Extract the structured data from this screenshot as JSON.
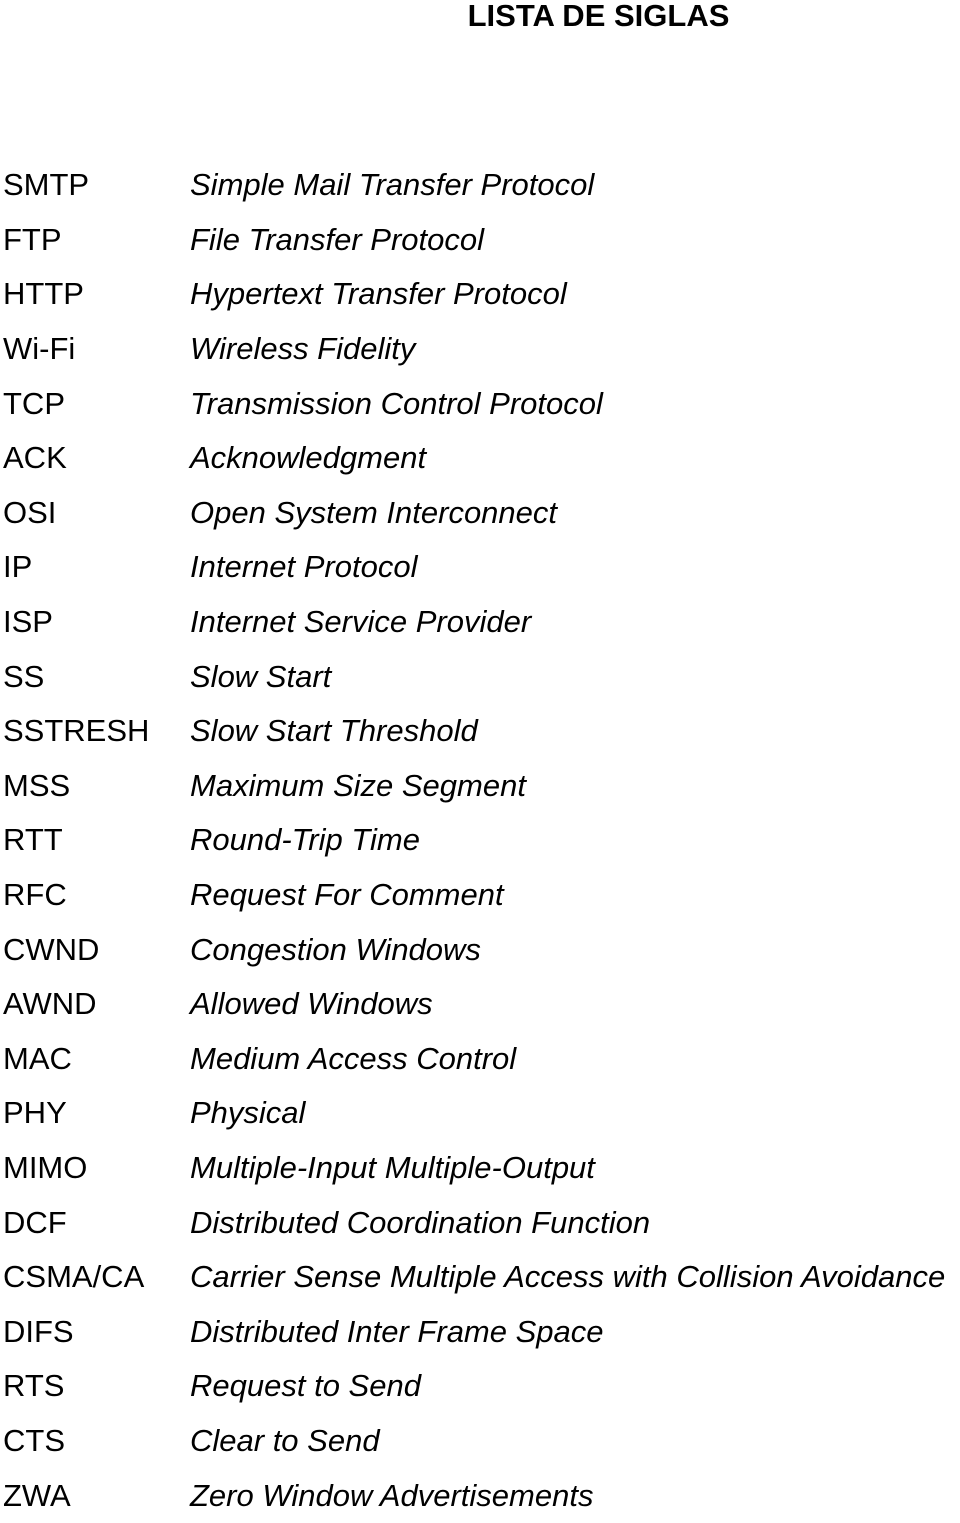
{
  "title": "LISTA DE SIGLAS",
  "entries": [
    {
      "abbr": "SMTP",
      "def": "Simple Mail Transfer Protocol"
    },
    {
      "abbr": "FTP",
      "def": "File Transfer Protocol"
    },
    {
      "abbr": "HTTP",
      "def": "Hypertext Transfer Protocol"
    },
    {
      "abbr": "Wi-Fi",
      "def": "Wireless Fidelity"
    },
    {
      "abbr": "TCP",
      "def": "Transmission Control Protocol"
    },
    {
      "abbr": "ACK",
      "def": "Acknowledgment"
    },
    {
      "abbr": "OSI",
      "def": "Open System Interconnect"
    },
    {
      "abbr": "IP",
      "def": "Internet Protocol"
    },
    {
      "abbr": "ISP",
      "def": "Internet Service Provider"
    },
    {
      "abbr": "SS",
      "def": "Slow Start"
    },
    {
      "abbr": "SSTRESH",
      "def": "Slow Start Threshold"
    },
    {
      "abbr": "MSS",
      "def": "Maximum Size Segment"
    },
    {
      "abbr": "RTT",
      "def": "Round-Trip Time"
    },
    {
      "abbr": "RFC",
      "def": "Request For Comment"
    },
    {
      "abbr": "CWND",
      "def": "Congestion Windows"
    },
    {
      "abbr": "AWND",
      "def": "Allowed Windows"
    },
    {
      "abbr": "MAC",
      "def": "Medium Access Control"
    },
    {
      "abbr": "PHY",
      "def": "Physical"
    },
    {
      "abbr": "MIMO",
      "def": "Multiple-Input Multiple-Output"
    },
    {
      "abbr": "DCF",
      "def": "Distributed Coordination Function"
    },
    {
      "abbr": "CSMA/CA",
      "def": "Carrier Sense Multiple Access with Collision Avoidance"
    },
    {
      "abbr": "DIFS",
      "def": "Distributed Inter Frame Space"
    },
    {
      "abbr": "RTS",
      "def": "Request to Send"
    },
    {
      "abbr": "CTS",
      "def": "Clear to Send"
    },
    {
      "abbr": "ZWA",
      "def": "Zero Window Advertisements"
    }
  ]
}
